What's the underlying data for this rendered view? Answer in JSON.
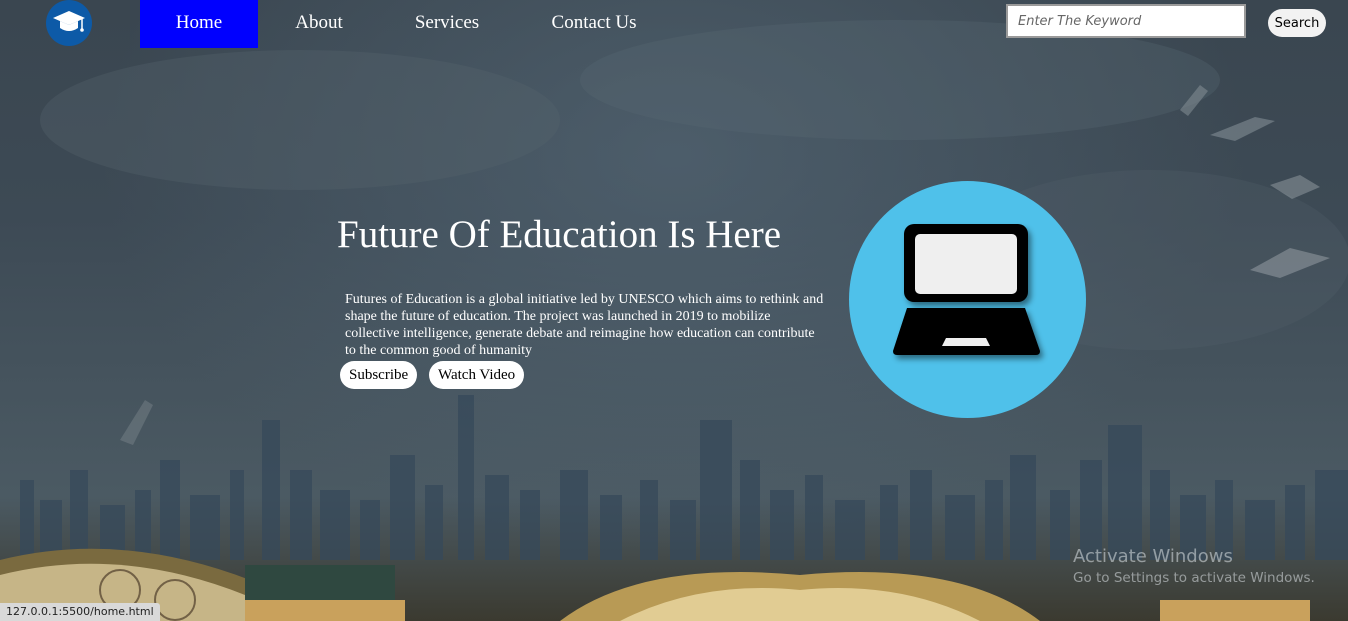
{
  "nav": {
    "items": [
      {
        "label": "Home",
        "active": true
      },
      {
        "label": "About"
      },
      {
        "label": "Services"
      },
      {
        "label": "Contact Us"
      }
    ],
    "logo_icon": "graduation-cap-icon"
  },
  "search": {
    "placeholder": "Enter The Keyword",
    "value": "",
    "button_label": "Search"
  },
  "hero": {
    "title": "Future Of Education Is Here",
    "text": "Futures of Education is a global initiative led by UNESCO which aims to rethink and shape the future of education. The project was launched in 2019 to mobilize collective intelligence, generate debate and reimagine how education can contribute to the common good of humanity",
    "subscribe_label": "Subscribe",
    "watch_label": "Watch Video",
    "image_icon": "laptop-icon"
  },
  "watermark": {
    "line1": "Activate Windows",
    "line2": "Go to Settings to activate Windows."
  },
  "status_url": "127.0.0.1:5500/home.html",
  "colors": {
    "nav_active": "#0000ff",
    "logo_bg": "#0d5aa7",
    "hero_circle": "#4fc1ea"
  }
}
